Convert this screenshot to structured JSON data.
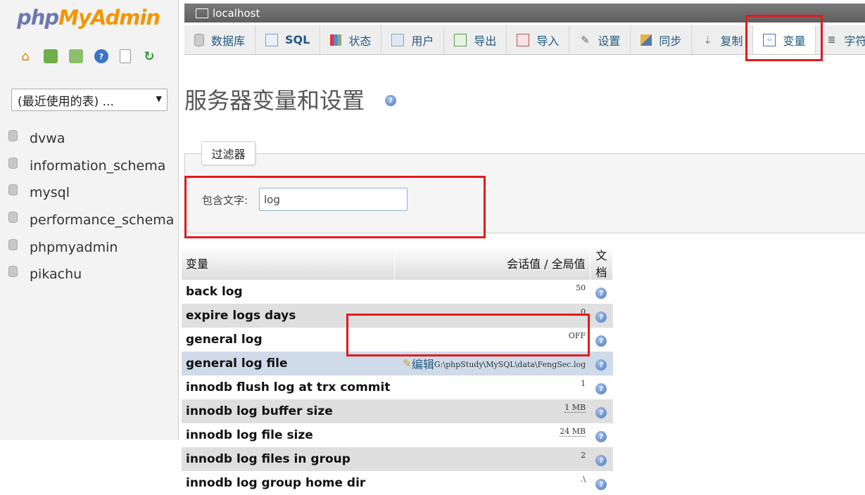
{
  "app": {
    "logo_php": "php",
    "logo_myadmin": "MyAdmin"
  },
  "left": {
    "nav_icons": [
      "home-icon",
      "exit-icon",
      "sql-query-icon",
      "help-icon",
      "docs-icon",
      "reload-icon"
    ],
    "recent_select": "(最近使用的表) ...",
    "databases": [
      "dvwa",
      "information_schema",
      "mysql",
      "performance_schema",
      "phpmyadmin",
      "pikachu"
    ]
  },
  "topbar": {
    "server": "localhost"
  },
  "tabs": [
    {
      "label": "数据库",
      "icon": "database-icon"
    },
    {
      "label": "SQL",
      "icon": "sql-icon"
    },
    {
      "label": "状态",
      "icon": "status-icon"
    },
    {
      "label": "用户",
      "icon": "users-icon"
    },
    {
      "label": "导出",
      "icon": "export-icon"
    },
    {
      "label": "导入",
      "icon": "import-icon"
    },
    {
      "label": "设置",
      "icon": "settings-icon"
    },
    {
      "label": "同步",
      "icon": "sync-icon"
    },
    {
      "label": "复制",
      "icon": "replication-icon"
    },
    {
      "label": "变量",
      "icon": "variables-icon",
      "active": true
    },
    {
      "label": "字符",
      "icon": "charset-icon"
    }
  ],
  "page": {
    "title": "服务器变量和设置"
  },
  "filter": {
    "legend": "过滤器",
    "label": "包含文字:",
    "value": "log"
  },
  "table": {
    "headers": {
      "variable": "变量",
      "value": "会话值 / 全局值",
      "doc": "文档"
    },
    "rows": [
      {
        "name": "back log",
        "value": "50"
      },
      {
        "name": "expire logs days",
        "value": "0"
      },
      {
        "name": "general log",
        "value": "OFF"
      },
      {
        "name": "general log file",
        "value": "G:\\phpStudy\\MySQL\\data\\FengSec.log",
        "edit_label": "编辑"
      },
      {
        "name": "innodb flush log at trx commit",
        "value": "1"
      },
      {
        "name": "innodb log buffer size",
        "value": "1 MB"
      },
      {
        "name": "innodb log file size",
        "value": "24 MB"
      },
      {
        "name": "innodb log files in group",
        "value": "2"
      },
      {
        "name": "innodb log group home dir",
        "value": ".\\"
      }
    ]
  },
  "colors": {
    "highlight_box": "#e21b1b",
    "link": "#235a81",
    "logo_php": "#6c78af",
    "logo_myadmin": "#f29600"
  }
}
